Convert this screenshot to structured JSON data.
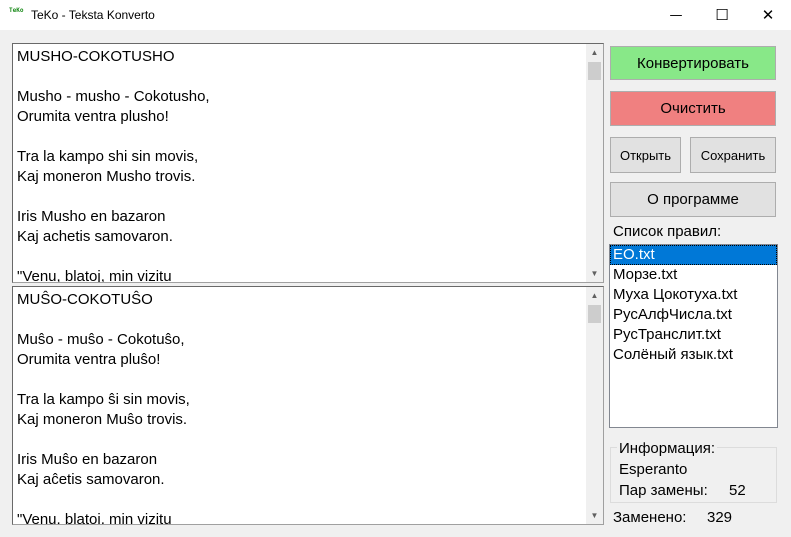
{
  "window": {
    "title": "TeKo - Teksta Konverto",
    "icon_text": "TeKo",
    "minimize_glyph": "—",
    "maximize_glyph": "☐",
    "close_glyph": "✕"
  },
  "source_text": "MUSHO-COKOTUSHO\n\nMusho - musho - Cokotusho,\nOrumita ventra plusho!\n\nTra la kampo shi sin movis,\nKaj moneron Musho trovis.\n\nIris Musho en bazaron\nKaj achetis samovaron.\n\n\"Venu, blatoj, min vizitu",
  "result_text": "MUŜO-COKOTUŜO\n\nMuŝo - muŝo - Cokotuŝo,\nOrumita ventra pluŝo!\n\nTra la kampo ŝi sin movis,\nKaj moneron Muŝo trovis.\n\nIris Muŝo en bazaron\nKaj aĉetis samovaron.\n\n\"Venu, blatoj, min vizitu",
  "buttons": {
    "convert": "Конвертировать",
    "clear": "Очистить",
    "open": "Открыть",
    "save": "Сохранить",
    "about": "О программе"
  },
  "colors": {
    "convert_bg": "#88e888",
    "clear_bg": "#f08080",
    "selection": "#0078d7"
  },
  "rules": {
    "label": "Список правил:",
    "items": [
      "EO.txt",
      "Морзе.txt",
      "Муха Цокотуха.txt",
      "РусАлфЧисла.txt",
      "РусТранслит.txt",
      "Солёный язык.txt"
    ],
    "selected": "EO.txt"
  },
  "info": {
    "title": "Информация:",
    "language": "Esperanto",
    "pairs_label": "Пар замены:",
    "pairs_value": "52"
  },
  "replaced": {
    "label": "Заменено:",
    "value": "329"
  },
  "icons": {
    "scroll_up": "scroll-up-arrow-icon",
    "scroll_down": "scroll-down-arrow-icon"
  }
}
